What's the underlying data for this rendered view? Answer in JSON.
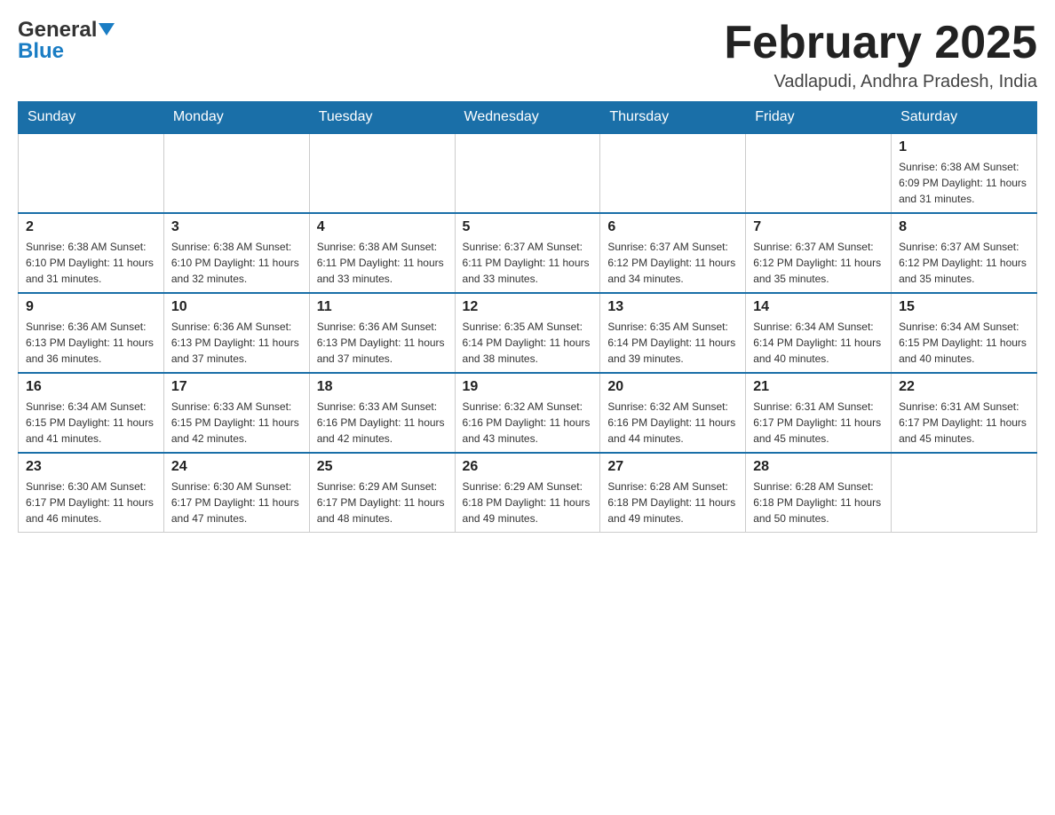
{
  "header": {
    "logo_general": "General",
    "logo_blue": "Blue",
    "month_title": "February 2025",
    "location": "Vadlapudi, Andhra Pradesh, India"
  },
  "days_of_week": [
    "Sunday",
    "Monday",
    "Tuesday",
    "Wednesday",
    "Thursday",
    "Friday",
    "Saturday"
  ],
  "weeks": [
    [
      {
        "day": "",
        "info": ""
      },
      {
        "day": "",
        "info": ""
      },
      {
        "day": "",
        "info": ""
      },
      {
        "day": "",
        "info": ""
      },
      {
        "day": "",
        "info": ""
      },
      {
        "day": "",
        "info": ""
      },
      {
        "day": "1",
        "info": "Sunrise: 6:38 AM\nSunset: 6:09 PM\nDaylight: 11 hours and 31 minutes."
      }
    ],
    [
      {
        "day": "2",
        "info": "Sunrise: 6:38 AM\nSunset: 6:10 PM\nDaylight: 11 hours and 31 minutes."
      },
      {
        "day": "3",
        "info": "Sunrise: 6:38 AM\nSunset: 6:10 PM\nDaylight: 11 hours and 32 minutes."
      },
      {
        "day": "4",
        "info": "Sunrise: 6:38 AM\nSunset: 6:11 PM\nDaylight: 11 hours and 33 minutes."
      },
      {
        "day": "5",
        "info": "Sunrise: 6:37 AM\nSunset: 6:11 PM\nDaylight: 11 hours and 33 minutes."
      },
      {
        "day": "6",
        "info": "Sunrise: 6:37 AM\nSunset: 6:12 PM\nDaylight: 11 hours and 34 minutes."
      },
      {
        "day": "7",
        "info": "Sunrise: 6:37 AM\nSunset: 6:12 PM\nDaylight: 11 hours and 35 minutes."
      },
      {
        "day": "8",
        "info": "Sunrise: 6:37 AM\nSunset: 6:12 PM\nDaylight: 11 hours and 35 minutes."
      }
    ],
    [
      {
        "day": "9",
        "info": "Sunrise: 6:36 AM\nSunset: 6:13 PM\nDaylight: 11 hours and 36 minutes."
      },
      {
        "day": "10",
        "info": "Sunrise: 6:36 AM\nSunset: 6:13 PM\nDaylight: 11 hours and 37 minutes."
      },
      {
        "day": "11",
        "info": "Sunrise: 6:36 AM\nSunset: 6:13 PM\nDaylight: 11 hours and 37 minutes."
      },
      {
        "day": "12",
        "info": "Sunrise: 6:35 AM\nSunset: 6:14 PM\nDaylight: 11 hours and 38 minutes."
      },
      {
        "day": "13",
        "info": "Sunrise: 6:35 AM\nSunset: 6:14 PM\nDaylight: 11 hours and 39 minutes."
      },
      {
        "day": "14",
        "info": "Sunrise: 6:34 AM\nSunset: 6:14 PM\nDaylight: 11 hours and 40 minutes."
      },
      {
        "day": "15",
        "info": "Sunrise: 6:34 AM\nSunset: 6:15 PM\nDaylight: 11 hours and 40 minutes."
      }
    ],
    [
      {
        "day": "16",
        "info": "Sunrise: 6:34 AM\nSunset: 6:15 PM\nDaylight: 11 hours and 41 minutes."
      },
      {
        "day": "17",
        "info": "Sunrise: 6:33 AM\nSunset: 6:15 PM\nDaylight: 11 hours and 42 minutes."
      },
      {
        "day": "18",
        "info": "Sunrise: 6:33 AM\nSunset: 6:16 PM\nDaylight: 11 hours and 42 minutes."
      },
      {
        "day": "19",
        "info": "Sunrise: 6:32 AM\nSunset: 6:16 PM\nDaylight: 11 hours and 43 minutes."
      },
      {
        "day": "20",
        "info": "Sunrise: 6:32 AM\nSunset: 6:16 PM\nDaylight: 11 hours and 44 minutes."
      },
      {
        "day": "21",
        "info": "Sunrise: 6:31 AM\nSunset: 6:17 PM\nDaylight: 11 hours and 45 minutes."
      },
      {
        "day": "22",
        "info": "Sunrise: 6:31 AM\nSunset: 6:17 PM\nDaylight: 11 hours and 45 minutes."
      }
    ],
    [
      {
        "day": "23",
        "info": "Sunrise: 6:30 AM\nSunset: 6:17 PM\nDaylight: 11 hours and 46 minutes."
      },
      {
        "day": "24",
        "info": "Sunrise: 6:30 AM\nSunset: 6:17 PM\nDaylight: 11 hours and 47 minutes."
      },
      {
        "day": "25",
        "info": "Sunrise: 6:29 AM\nSunset: 6:17 PM\nDaylight: 11 hours and 48 minutes."
      },
      {
        "day": "26",
        "info": "Sunrise: 6:29 AM\nSunset: 6:18 PM\nDaylight: 11 hours and 49 minutes."
      },
      {
        "day": "27",
        "info": "Sunrise: 6:28 AM\nSunset: 6:18 PM\nDaylight: 11 hours and 49 minutes."
      },
      {
        "day": "28",
        "info": "Sunrise: 6:28 AM\nSunset: 6:18 PM\nDaylight: 11 hours and 50 minutes."
      },
      {
        "day": "",
        "info": ""
      }
    ]
  ]
}
